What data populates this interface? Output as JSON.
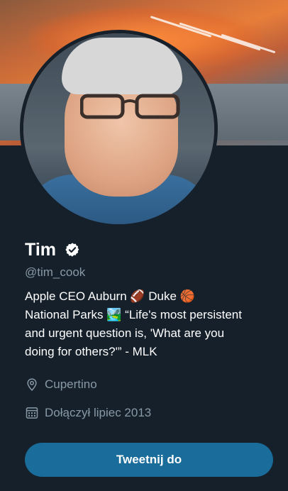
{
  "profile": {
    "name": "Tim",
    "name_glyph": "",
    "handle": "@tim_cook",
    "bio_lines": [
      "Apple CEO  Auburn 🏈 Duke 🏀",
      "National Parks 🏞️ “Life's most persistent",
      "and urgent question is, 'What are you",
      "doing for others?'” - MLK"
    ],
    "location": "Cupertino",
    "joined": "Dołączył lipiec 2013"
  },
  "icons": {
    "verified": "verified-badge-icon",
    "location": "location-pin-icon",
    "calendar": "calendar-icon"
  },
  "actions": {
    "tweet_to_label": "Tweetnij do"
  },
  "colors": {
    "background": "#15202b",
    "secondary_text": "#8899a6",
    "button": "#1a6c9a"
  }
}
